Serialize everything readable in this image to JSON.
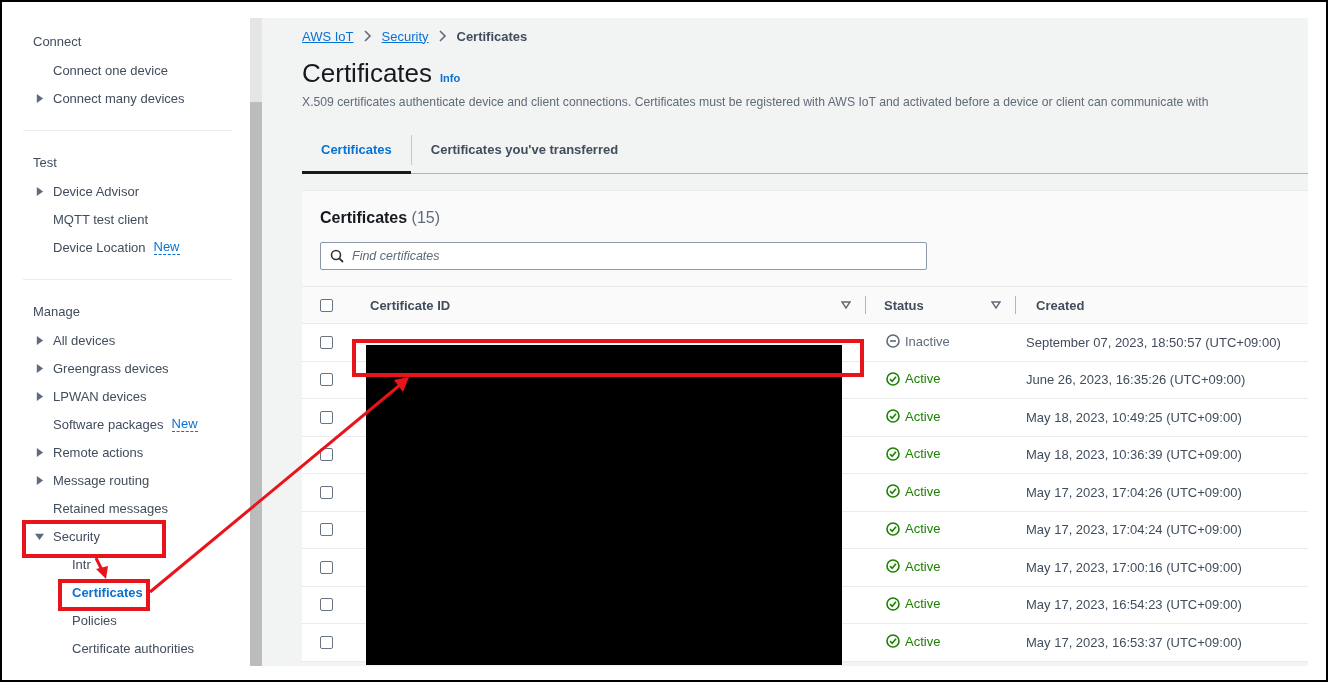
{
  "sidebar": {
    "sections": [
      {
        "heading": "Connect",
        "items": [
          {
            "label": "Connect one device",
            "kind": "link",
            "selected": false
          },
          {
            "label": "Connect many devices",
            "kind": "group",
            "expanded": false,
            "selected": false
          }
        ]
      },
      {
        "heading": "Test",
        "items": [
          {
            "label": "Device Advisor",
            "kind": "group",
            "expanded": false,
            "selected": false
          },
          {
            "label": "MQTT test client",
            "kind": "link",
            "selected": false
          },
          {
            "label": "Device Location",
            "kind": "link",
            "badge": "New",
            "selected": false
          }
        ]
      },
      {
        "heading": "Manage",
        "items": [
          {
            "label": "All devices",
            "kind": "group",
            "expanded": false,
            "selected": false
          },
          {
            "label": "Greengrass devices",
            "kind": "group",
            "expanded": false,
            "selected": false
          },
          {
            "label": "LPWAN devices",
            "kind": "group",
            "expanded": false,
            "selected": false
          },
          {
            "label": "Software packages",
            "kind": "link",
            "badge": "New",
            "selected": false
          },
          {
            "label": "Remote actions",
            "kind": "group",
            "expanded": false,
            "selected": false
          },
          {
            "label": "Message routing",
            "kind": "group",
            "expanded": false,
            "selected": false
          },
          {
            "label": "Retained messages",
            "kind": "link",
            "selected": false
          },
          {
            "label": "Security",
            "kind": "group",
            "expanded": true,
            "selected": false,
            "children": [
              {
                "label": "Intr",
                "selected": false
              },
              {
                "label": "Certificates",
                "selected": true
              },
              {
                "label": "Policies",
                "selected": false
              },
              {
                "label": "Certificate authorities",
                "selected": false
              }
            ]
          }
        ]
      }
    ]
  },
  "breadcrumb": [
    {
      "label": "AWS IoT",
      "link": true
    },
    {
      "label": "Security",
      "link": true
    },
    {
      "label": "Certificates",
      "link": false
    }
  ],
  "page": {
    "title": "Certificates",
    "info": "Info",
    "description": "X.509 certificates authenticate device and client connections. Certificates must be registered with AWS IoT and activated before a device or client can communicate with"
  },
  "tabs": [
    {
      "label": "Certificates",
      "selected": true
    },
    {
      "label": "Certificates you've transferred",
      "selected": false
    }
  ],
  "table": {
    "title": "Certificates",
    "count": "(15)",
    "search": {
      "placeholder": "Find certificates"
    },
    "select_all": {
      "checked": false
    },
    "columns": [
      {
        "label": "Certificate ID",
        "filter": true
      },
      {
        "label": "Status",
        "filter": true
      },
      {
        "label": "Created",
        "filter": false
      }
    ],
    "rows": [
      {
        "checked": false,
        "status": {
          "kind": "inactive",
          "label": "Inactive"
        },
        "created": "September 07, 2023, 18:50:57 (UTC+09:00)"
      },
      {
        "checked": false,
        "status": {
          "kind": "active",
          "label": "Active"
        },
        "created": "June 26, 2023, 16:35:26 (UTC+09:00)"
      },
      {
        "checked": false,
        "status": {
          "kind": "active",
          "label": "Active"
        },
        "created": "May 18, 2023, 10:49:25 (UTC+09:00)"
      },
      {
        "checked": false,
        "status": {
          "kind": "active",
          "label": "Active"
        },
        "created": "May 18, 2023, 10:36:39 (UTC+09:00)"
      },
      {
        "checked": false,
        "status": {
          "kind": "active",
          "label": "Active"
        },
        "created": "May 17, 2023, 17:04:26 (UTC+09:00)"
      },
      {
        "checked": false,
        "status": {
          "kind": "active",
          "label": "Active"
        },
        "created": "May 17, 2023, 17:04:24 (UTC+09:00)"
      },
      {
        "checked": false,
        "status": {
          "kind": "active",
          "label": "Active"
        },
        "created": "May 17, 2023, 17:00:16 (UTC+09:00)"
      },
      {
        "checked": false,
        "status": {
          "kind": "active",
          "label": "Active"
        },
        "created": "May 17, 2023, 16:54:23 (UTC+09:00)"
      },
      {
        "checked": false,
        "status": {
          "kind": "active",
          "label": "Active"
        },
        "created": "May 17, 2023, 16:53:37 (UTC+09:00)"
      }
    ]
  }
}
